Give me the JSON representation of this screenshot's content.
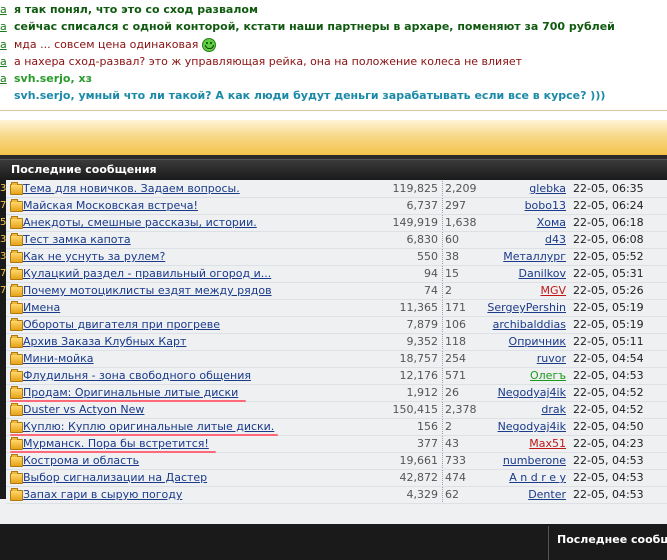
{
  "chat": {
    "messages": [
      {
        "nick": "a",
        "text": "я так понял, что это со сход развалом",
        "style": "dark-green"
      },
      {
        "nick": "a",
        "text": "сейчас списался с одной конторой, кстати наши партнеры в архаре, поменяют за 700 рублей",
        "style": "dark-green"
      },
      {
        "nick": "a",
        "text": "мда ... совсем цена одинаковая",
        "style": "dark-red",
        "smiley": "smiley-icon"
      },
      {
        "nick": "a",
        "text": "а нахера сход-развал? это ж управляющая рейка, она на положение колеса не влияет",
        "style": "dark-red"
      },
      {
        "nick": "a",
        "text": "svh.serjo, хз",
        "style": "green"
      },
      {
        "nick": "",
        "text": "svh.serjo, умный что ли такой? А как люди будут деньги зарабатывать если все в курсе? )))",
        "style": "teal"
      }
    ]
  },
  "forum": {
    "header_title": "Последние сообщения",
    "footer_title": "Последнее сообщ",
    "rows": [
      {
        "edge": "3",
        "topic": "Тема для новичков. Задаем вопросы.",
        "views": "119,825",
        "replies": "2,209",
        "author": "glebka",
        "author_color": "blue",
        "time": "22-05, 06:35"
      },
      {
        "edge": "7",
        "topic": "Майская Московская встреча!",
        "views": "6,737",
        "replies": "297",
        "author": "bobo13",
        "author_color": "blue",
        "time": "22-05, 06:24"
      },
      {
        "edge": "5",
        "topic": "Анекдоты, смешные рассказы, истории.",
        "views": "149,919",
        "replies": "1,638",
        "author": "Хома",
        "author_color": "blue",
        "time": "22-05, 06:18"
      },
      {
        "edge": "3",
        "topic": "Тест замка капота",
        "views": "6,830",
        "replies": "60",
        "author": "d43",
        "author_color": "blue",
        "time": "22-05, 06:08"
      },
      {
        "edge": "3",
        "topic": "Как не уснуть за рулем?",
        "views": "550",
        "replies": "38",
        "author": "Металлург",
        "author_color": "blue",
        "time": "22-05, 05:52"
      },
      {
        "edge": "7",
        "topic": "Кулацкий раздел - правильный огород и...",
        "views": "94",
        "replies": "15",
        "author": "Danilkov",
        "author_color": "blue",
        "time": "22-05, 05:31"
      },
      {
        "edge": "7",
        "topic": "Почему мотоциклисты ездят между рядов",
        "views": "74",
        "replies": "2",
        "author": "MGV",
        "author_color": "red",
        "time": "22-05, 05:26"
      },
      {
        "edge": "",
        "topic": "Имена",
        "views": "11,365",
        "replies": "171",
        "author": "SergeyPershin",
        "author_color": "blue",
        "time": "22-05, 05:19"
      },
      {
        "edge": "",
        "topic": "Обороты двигателя при прогреве",
        "views": "7,879",
        "replies": "106",
        "author": "archibalddias",
        "author_color": "blue",
        "time": "22-05, 05:19"
      },
      {
        "edge": "",
        "topic": "Архив Заказа Клубных Карт",
        "views": "9,352",
        "replies": "118",
        "author": "Опричник",
        "author_color": "blue",
        "time": "22-05, 05:11"
      },
      {
        "edge": "",
        "topic": "Мини-мойка",
        "views": "18,757",
        "replies": "254",
        "author": "ruvor",
        "author_color": "blue",
        "time": "22-05, 04:54"
      },
      {
        "edge": "",
        "topic": "Флудильня - зона свободного общения",
        "views": "12,176",
        "replies": "571",
        "author": "Олегъ",
        "author_color": "green",
        "time": "22-05, 04:53"
      },
      {
        "edge": "",
        "topic": "Продам: Оригинальные литые диски",
        "views": "1,912",
        "replies": "26",
        "author": "Negodyaj4ik",
        "author_color": "blue",
        "time": "22-05, 04:52",
        "highlight": true
      },
      {
        "edge": "",
        "topic": "Duster vs Actyon New",
        "views": "150,415",
        "replies": "2,378",
        "author": "drak",
        "author_color": "blue",
        "time": "22-05, 04:52"
      },
      {
        "edge": "",
        "topic": "Куплю: Куплю оригинальные литые диски.",
        "views": "156",
        "replies": "2",
        "author": "Negodyaj4ik",
        "author_color": "blue",
        "time": "22-05, 04:50",
        "highlight": true
      },
      {
        "edge": "",
        "topic": "Мурманск. Пора бы встретится!",
        "views": "377",
        "replies": "43",
        "author": "Max51",
        "author_color": "red",
        "time": "22-05, 04:23",
        "highlight": true
      },
      {
        "edge": "",
        "topic": "Кострома и область",
        "views": "19,661",
        "replies": "733",
        "author": "numberone",
        "author_color": "blue",
        "time": "22-05, 04:53"
      },
      {
        "edge": "",
        "topic": "Выбор сигнализации на Дастер",
        "views": "42,872",
        "replies": "474",
        "author": "A n d r e y",
        "author_color": "blue",
        "time": "22-05, 04:53"
      },
      {
        "edge": "",
        "topic": "Запах гари в сырую погоду",
        "views": "4,329",
        "replies": "62",
        "author": "Denter",
        "author_color": "blue",
        "time": "22-05, 04:53"
      }
    ]
  }
}
